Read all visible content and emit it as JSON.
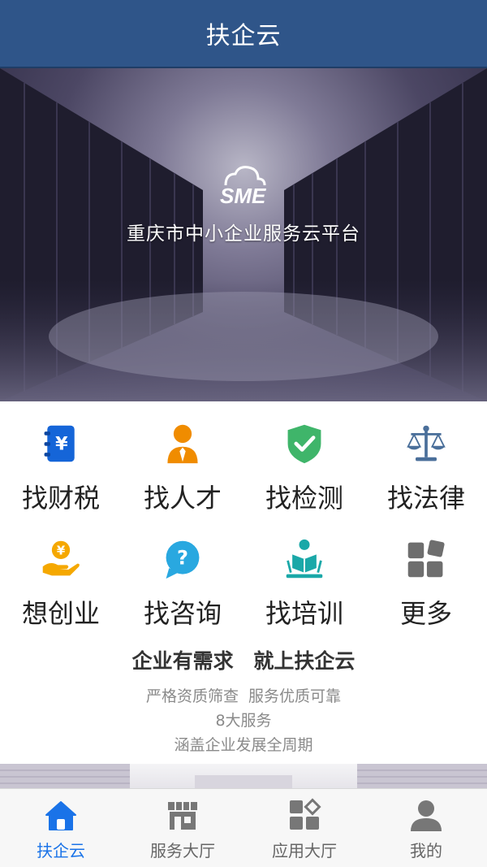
{
  "header": {
    "title": "扶企云"
  },
  "banner": {
    "logo_text": "SME",
    "title": "重庆市中小企业服务云平台"
  },
  "services": [
    {
      "label": "找财税",
      "icon": "tax-book-icon",
      "color": "#1565d8"
    },
    {
      "label": "找人才",
      "icon": "talent-person-icon",
      "color": "#f08c00"
    },
    {
      "label": "找检测",
      "icon": "check-shield-icon",
      "color": "#3fb56a"
    },
    {
      "label": "找法律",
      "icon": "scales-icon",
      "color": "#4a6f9a"
    },
    {
      "label": "想创业",
      "icon": "startup-money-icon",
      "color": "#f5a800"
    },
    {
      "label": "找咨询",
      "icon": "question-bubble-icon",
      "color": "#29a8e0"
    },
    {
      "label": "找培训",
      "icon": "training-reader-icon",
      "color": "#1aa8a8"
    },
    {
      "label": "更多",
      "icon": "more-grid-icon",
      "color": "#6e6e6e"
    }
  ],
  "slogan": {
    "part1": "企业有需求",
    "part2": "就上扶企云"
  },
  "description": [
    "严格资质筛查  服务优质可靠",
    "8大服务",
    "涵盖企业发展全周期"
  ],
  "tabbar": {
    "active_color": "#1a73e8",
    "items": [
      {
        "label": "扶企云",
        "icon": "home-icon",
        "active": true
      },
      {
        "label": "服务大厅",
        "icon": "storefront-icon",
        "active": false
      },
      {
        "label": "应用大厅",
        "icon": "apps-icon",
        "active": false
      },
      {
        "label": "我的",
        "icon": "user-icon",
        "active": false
      }
    ]
  }
}
